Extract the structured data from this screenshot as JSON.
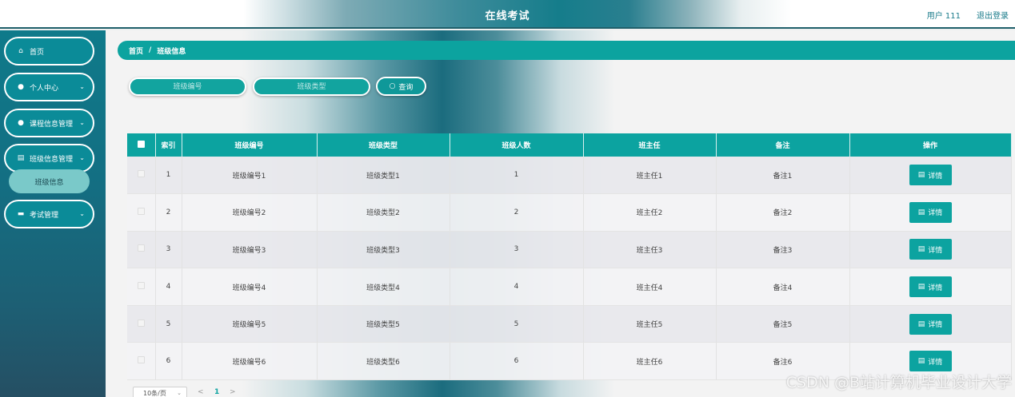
{
  "header": {
    "title": "在线考试",
    "user": "用户 111",
    "logout": "退出登录"
  },
  "sidebar": {
    "items": [
      {
        "label": "首页",
        "icon": "home-icon",
        "glyph": "⌂",
        "chevron": ""
      },
      {
        "label": "个人中心",
        "icon": "user-icon",
        "glyph": "●",
        "chevron": "⌄"
      },
      {
        "label": "课程信息管理",
        "icon": "user-icon",
        "glyph": "●",
        "chevron": "⌄"
      },
      {
        "label": "班级信息管理",
        "icon": "clipboard-icon",
        "glyph": "▤",
        "chevron": "⌄"
      },
      {
        "label": "考试管理",
        "icon": "briefcase-icon",
        "glyph": "▬",
        "chevron": "⌄"
      }
    ],
    "submenu": "班级信息"
  },
  "breadcrumb": {
    "home": "首页",
    "separator": "/",
    "current": "班级信息"
  },
  "search": {
    "class_no_placeholder": "班级编号",
    "class_type_placeholder": "班级类型",
    "button_label": "查询",
    "button_glyph": "○"
  },
  "table": {
    "headers": [
      "索引",
      "班级编号",
      "班级类型",
      "班级人数",
      "班主任",
      "备注",
      "操作"
    ],
    "detail_label": "详情",
    "detail_glyph": "▤",
    "rows": [
      {
        "index": "1",
        "class_no": "班级编号1",
        "class_type": "班级类型1",
        "count": "1",
        "teacher": "班主任1",
        "note": "备注1"
      },
      {
        "index": "2",
        "class_no": "班级编号2",
        "class_type": "班级类型2",
        "count": "2",
        "teacher": "班主任2",
        "note": "备注2"
      },
      {
        "index": "3",
        "class_no": "班级编号3",
        "class_type": "班级类型3",
        "count": "3",
        "teacher": "班主任3",
        "note": "备注3"
      },
      {
        "index": "4",
        "class_no": "班级编号4",
        "class_type": "班级类型4",
        "count": "4",
        "teacher": "班主任4",
        "note": "备注4"
      },
      {
        "index": "5",
        "class_no": "班级编号5",
        "class_type": "班级类型5",
        "count": "5",
        "teacher": "班主任5",
        "note": "备注5"
      },
      {
        "index": "6",
        "class_no": "班级编号6",
        "class_type": "班级类型6",
        "count": "6",
        "teacher": "班主任6",
        "note": "备注6"
      }
    ]
  },
  "pagination": {
    "page_size": "10条/页",
    "prev": "<",
    "current": "1",
    "next": ">",
    "dropdown_glyph": "⌄"
  },
  "watermark": "CSDN @B站计算机毕业设计大学",
  "colors": {
    "accent": "#0ca3a0",
    "sidebar": "#0f7a8a",
    "header_text": "#1a7b8a"
  }
}
